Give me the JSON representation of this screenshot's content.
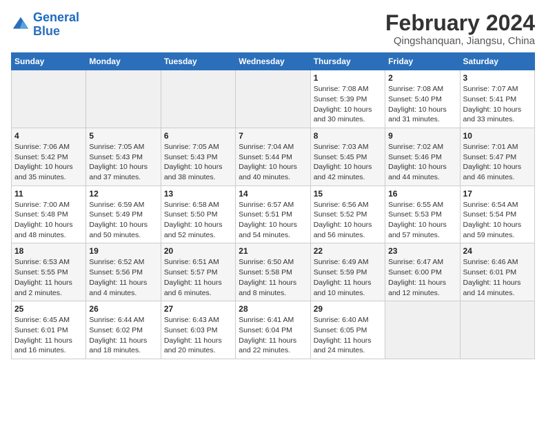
{
  "header": {
    "logo_line1": "General",
    "logo_line2": "Blue",
    "main_title": "February 2024",
    "subtitle": "Qingshanquan, Jiangsu, China"
  },
  "weekdays": [
    "Sunday",
    "Monday",
    "Tuesday",
    "Wednesday",
    "Thursday",
    "Friday",
    "Saturday"
  ],
  "weeks": [
    [
      {
        "day": "",
        "info": ""
      },
      {
        "day": "",
        "info": ""
      },
      {
        "day": "",
        "info": ""
      },
      {
        "day": "",
        "info": ""
      },
      {
        "day": "1",
        "info": "Sunrise: 7:08 AM\nSunset: 5:39 PM\nDaylight: 10 hours and 30 minutes."
      },
      {
        "day": "2",
        "info": "Sunrise: 7:08 AM\nSunset: 5:40 PM\nDaylight: 10 hours and 31 minutes."
      },
      {
        "day": "3",
        "info": "Sunrise: 7:07 AM\nSunset: 5:41 PM\nDaylight: 10 hours and 33 minutes."
      }
    ],
    [
      {
        "day": "4",
        "info": "Sunrise: 7:06 AM\nSunset: 5:42 PM\nDaylight: 10 hours and 35 minutes."
      },
      {
        "day": "5",
        "info": "Sunrise: 7:05 AM\nSunset: 5:43 PM\nDaylight: 10 hours and 37 minutes."
      },
      {
        "day": "6",
        "info": "Sunrise: 7:05 AM\nSunset: 5:43 PM\nDaylight: 10 hours and 38 minutes."
      },
      {
        "day": "7",
        "info": "Sunrise: 7:04 AM\nSunset: 5:44 PM\nDaylight: 10 hours and 40 minutes."
      },
      {
        "day": "8",
        "info": "Sunrise: 7:03 AM\nSunset: 5:45 PM\nDaylight: 10 hours and 42 minutes."
      },
      {
        "day": "9",
        "info": "Sunrise: 7:02 AM\nSunset: 5:46 PM\nDaylight: 10 hours and 44 minutes."
      },
      {
        "day": "10",
        "info": "Sunrise: 7:01 AM\nSunset: 5:47 PM\nDaylight: 10 hours and 46 minutes."
      }
    ],
    [
      {
        "day": "11",
        "info": "Sunrise: 7:00 AM\nSunset: 5:48 PM\nDaylight: 10 hours and 48 minutes."
      },
      {
        "day": "12",
        "info": "Sunrise: 6:59 AM\nSunset: 5:49 PM\nDaylight: 10 hours and 50 minutes."
      },
      {
        "day": "13",
        "info": "Sunrise: 6:58 AM\nSunset: 5:50 PM\nDaylight: 10 hours and 52 minutes."
      },
      {
        "day": "14",
        "info": "Sunrise: 6:57 AM\nSunset: 5:51 PM\nDaylight: 10 hours and 54 minutes."
      },
      {
        "day": "15",
        "info": "Sunrise: 6:56 AM\nSunset: 5:52 PM\nDaylight: 10 hours and 56 minutes."
      },
      {
        "day": "16",
        "info": "Sunrise: 6:55 AM\nSunset: 5:53 PM\nDaylight: 10 hours and 57 minutes."
      },
      {
        "day": "17",
        "info": "Sunrise: 6:54 AM\nSunset: 5:54 PM\nDaylight: 10 hours and 59 minutes."
      }
    ],
    [
      {
        "day": "18",
        "info": "Sunrise: 6:53 AM\nSunset: 5:55 PM\nDaylight: 11 hours and 2 minutes."
      },
      {
        "day": "19",
        "info": "Sunrise: 6:52 AM\nSunset: 5:56 PM\nDaylight: 11 hours and 4 minutes."
      },
      {
        "day": "20",
        "info": "Sunrise: 6:51 AM\nSunset: 5:57 PM\nDaylight: 11 hours and 6 minutes."
      },
      {
        "day": "21",
        "info": "Sunrise: 6:50 AM\nSunset: 5:58 PM\nDaylight: 11 hours and 8 minutes."
      },
      {
        "day": "22",
        "info": "Sunrise: 6:49 AM\nSunset: 5:59 PM\nDaylight: 11 hours and 10 minutes."
      },
      {
        "day": "23",
        "info": "Sunrise: 6:47 AM\nSunset: 6:00 PM\nDaylight: 11 hours and 12 minutes."
      },
      {
        "day": "24",
        "info": "Sunrise: 6:46 AM\nSunset: 6:01 PM\nDaylight: 11 hours and 14 minutes."
      }
    ],
    [
      {
        "day": "25",
        "info": "Sunrise: 6:45 AM\nSunset: 6:01 PM\nDaylight: 11 hours and 16 minutes."
      },
      {
        "day": "26",
        "info": "Sunrise: 6:44 AM\nSunset: 6:02 PM\nDaylight: 11 hours and 18 minutes."
      },
      {
        "day": "27",
        "info": "Sunrise: 6:43 AM\nSunset: 6:03 PM\nDaylight: 11 hours and 20 minutes."
      },
      {
        "day": "28",
        "info": "Sunrise: 6:41 AM\nSunset: 6:04 PM\nDaylight: 11 hours and 22 minutes."
      },
      {
        "day": "29",
        "info": "Sunrise: 6:40 AM\nSunset: 6:05 PM\nDaylight: 11 hours and 24 minutes."
      },
      {
        "day": "",
        "info": ""
      },
      {
        "day": "",
        "info": ""
      }
    ]
  ]
}
